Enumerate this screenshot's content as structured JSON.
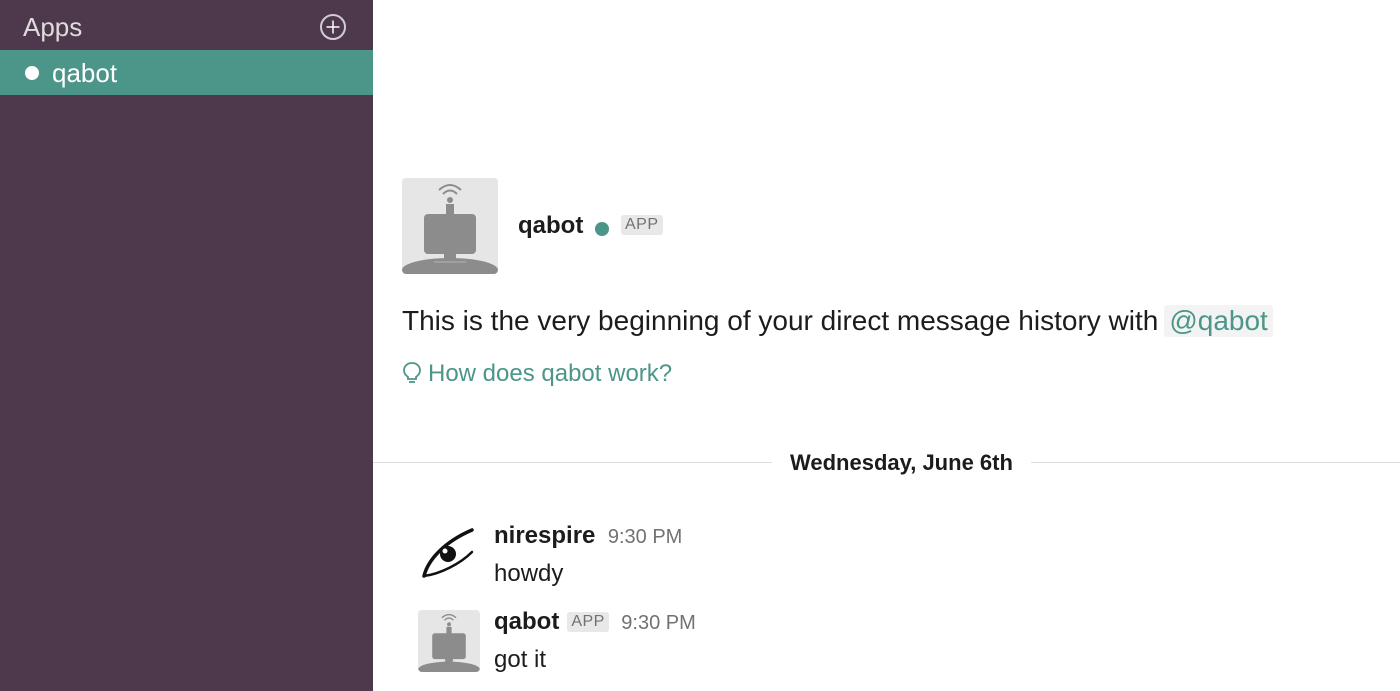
{
  "sidebar": {
    "section_label": "Apps",
    "add_icon": "plus-circle-icon",
    "items": [
      {
        "label": "qabot",
        "icon": "presence-dot-icon",
        "active": true
      }
    ]
  },
  "intro": {
    "name": "qabot",
    "badge": "APP",
    "text": "This is the very beginning of your direct message history with",
    "mention": "@qabot",
    "help_link": "How does qabot work?",
    "help_icon": "lightbulb-icon"
  },
  "date_divider": "Wednesday, June 6th",
  "messages": [
    {
      "author": "nirespire",
      "badge": "",
      "time": "9:30 PM",
      "text": "howdy"
    },
    {
      "author": "qabot",
      "badge": "APP",
      "time": "9:30 PM",
      "text": "got it"
    }
  ],
  "colors": {
    "sidebar_bg": "#4d394b",
    "active_item_bg": "#4c9689",
    "accent": "#4c9689",
    "presence_online": "#4c9689"
  }
}
